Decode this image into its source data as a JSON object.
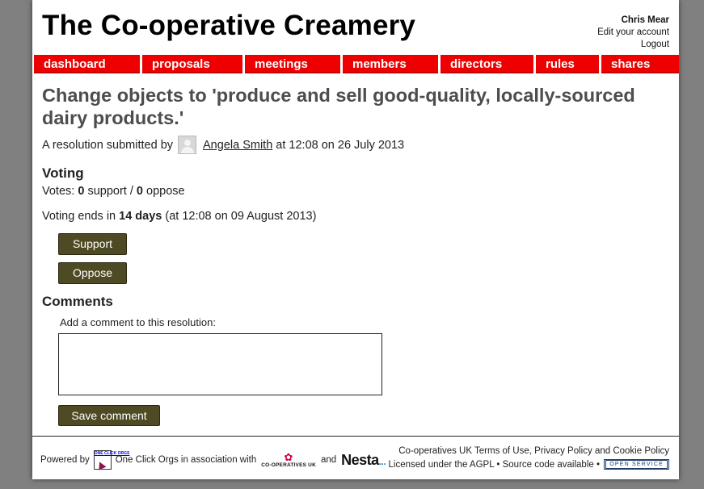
{
  "site": {
    "title": "The Co-operative Creamery"
  },
  "account": {
    "user": "Chris Mear",
    "edit": "Edit your account",
    "logout": "Logout"
  },
  "nav": [
    {
      "label": "dashboard"
    },
    {
      "label": "proposals"
    },
    {
      "label": "meetings"
    },
    {
      "label": "members"
    },
    {
      "label": "directors"
    },
    {
      "label": "rules"
    },
    {
      "label": "shares"
    }
  ],
  "resolution": {
    "title": "Change objects to 'produce and sell good-quality, locally-sourced dairy products.'",
    "submitted_prefix": "A resolution submitted by",
    "author": "Angela Smith",
    "submitted_suffix": "at 12:08 on 26 July 2013"
  },
  "voting": {
    "heading": "Voting",
    "votes_prefix": "Votes:",
    "support_count": "0",
    "support_word": "support /",
    "oppose_count": "0",
    "oppose_word": "oppose",
    "ends_prefix": "Voting ends in",
    "ends_days": "14 days",
    "ends_suffix": "(at 12:08 on 09 August 2013)",
    "support_button": "Support",
    "oppose_button": "Oppose"
  },
  "comments": {
    "heading": "Comments",
    "label": "Add a comment to this resolution:",
    "value": "",
    "save_button": "Save comment"
  },
  "footer": {
    "powered_by": "Powered by",
    "oco_logo_text": "ONE CLICK ORGS",
    "oco_name": "One Click Orgs",
    "association": "in association with",
    "coop_logo_text": "CO-OPERATIVES UK",
    "and": "and",
    "nesta": "Nesta",
    "coop_uk": "Co-operatives UK",
    "terms": "Terms of Use",
    "privacy": "Privacy Policy",
    "and2": "and",
    "cookie": "Cookie Policy",
    "licensed": "Licensed under the",
    "agpl": "AGPL",
    "source": "Source code available",
    "open_service": "OPEN SERVICE"
  },
  "colors": {
    "nav": "#ee0000",
    "button": "#4e4b24",
    "heading": "#4d4d4d"
  }
}
